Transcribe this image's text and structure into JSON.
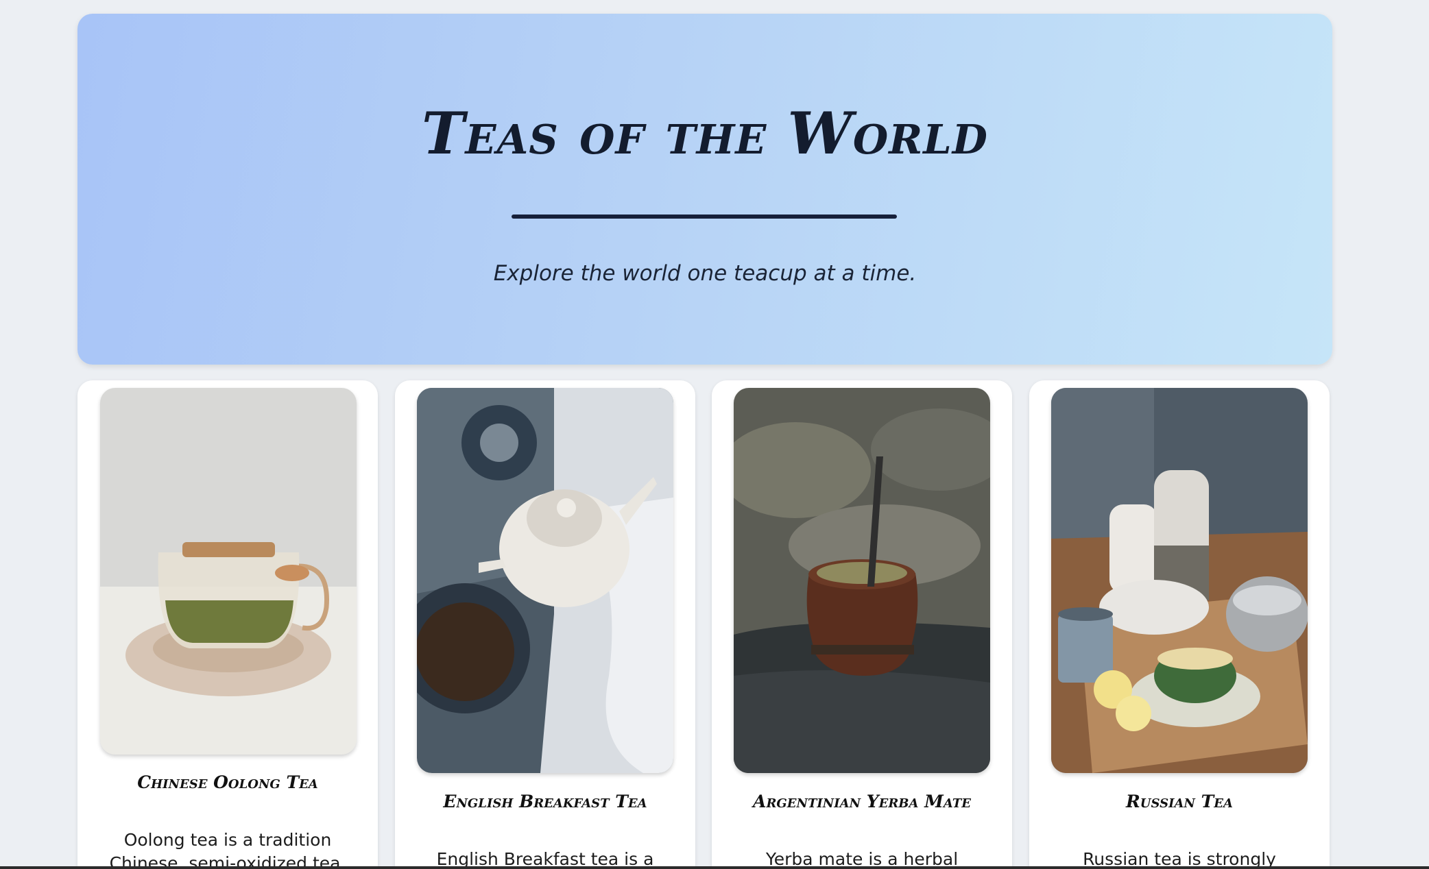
{
  "hero": {
    "title": "Teas of the World",
    "subtitle": "Explore the world one teacup at a time."
  },
  "cards": [
    {
      "title": "Chinese Oolong Tea",
      "description": "Oolong tea is a tradition Chinese, semi-oxidized tea. It's made by"
    },
    {
      "title": "English Breakfast Tea",
      "description": "English Breakfast tea is a blend"
    },
    {
      "title": "Argentinian Yerba Mate",
      "description": "Yerba mate is a herbal infusion,"
    },
    {
      "title": "Russian Tea",
      "description": "Russian tea is strongly steeped"
    }
  ],
  "colors": {
    "page_background": "#eceff3",
    "hero_gradient_start": "#a8c4f7",
    "hero_gradient_end": "#c6e5f8",
    "title_color": "#131c2e"
  }
}
